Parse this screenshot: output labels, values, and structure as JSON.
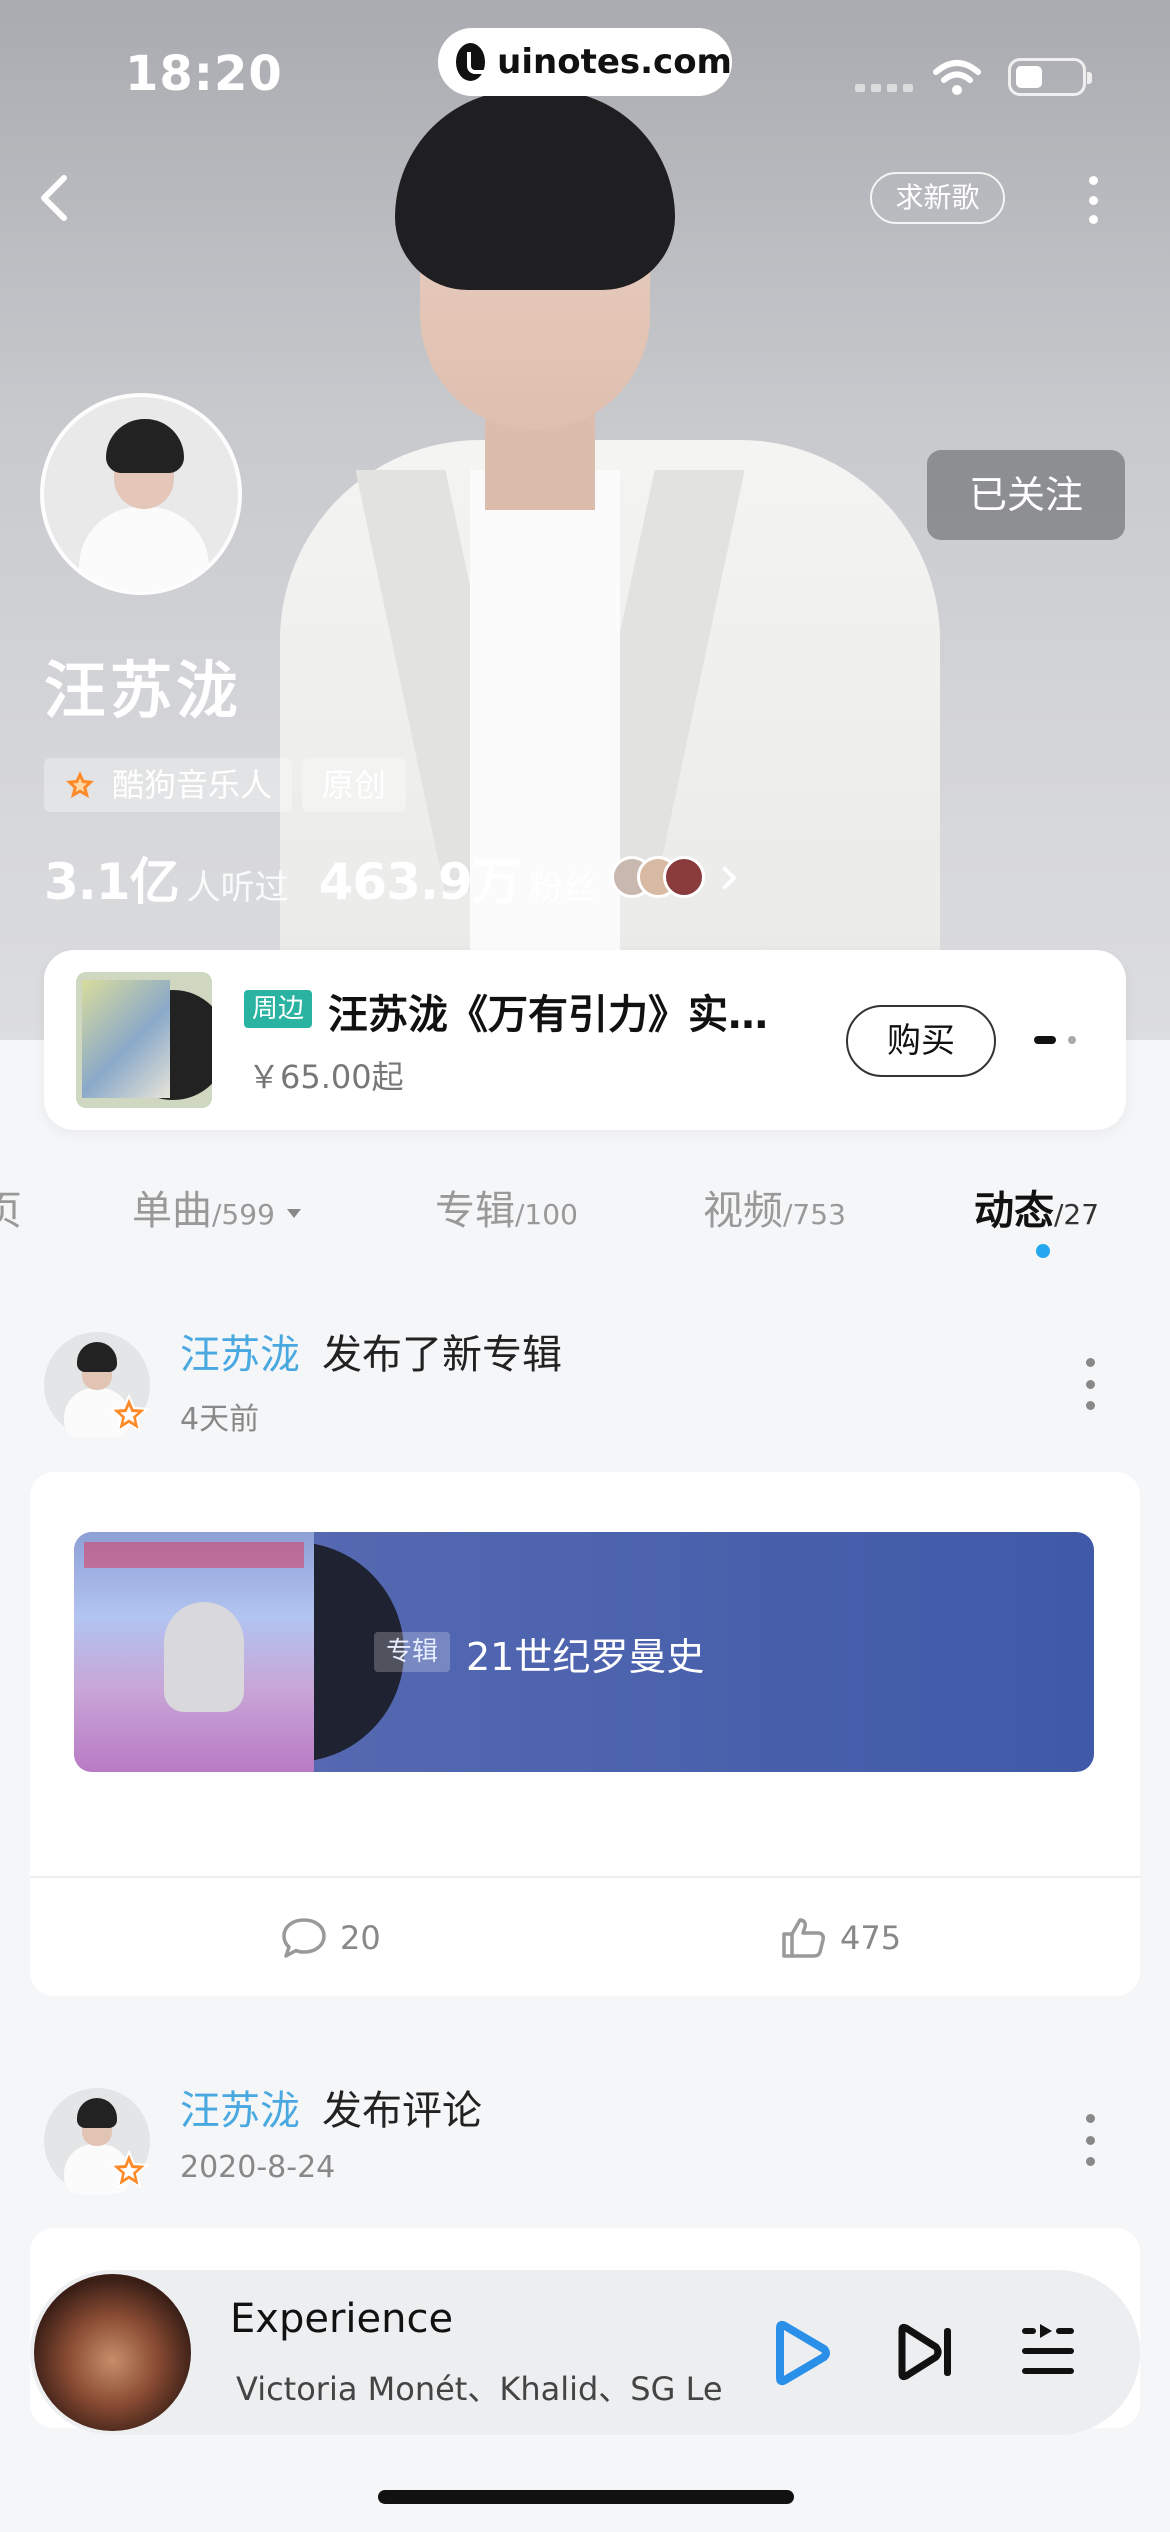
{
  "status_bar": {
    "time": "18:20",
    "url": "uinotes.com"
  },
  "header": {
    "request_song_label": "求新歌",
    "follow_label": "已关注"
  },
  "artist": {
    "name": "汪苏泷",
    "tags": [
      "酷狗音乐人",
      "原创"
    ],
    "listeners_value": "3.1亿",
    "listeners_label": "人听过",
    "fans_value": "463.9万",
    "fans_label": "粉丝"
  },
  "merch": {
    "tag": "周边",
    "title": "汪苏泷《万有引力》实…",
    "price": "￥65.00起",
    "buy_label": "购买"
  },
  "tabs": [
    {
      "label": "页",
      "count": ""
    },
    {
      "label": "单曲",
      "count": "/599"
    },
    {
      "label": "专辑",
      "count": "/100"
    },
    {
      "label": "视频",
      "count": "/753"
    },
    {
      "label": "动态",
      "count": "/27"
    }
  ],
  "active_tab": "动态",
  "feed": [
    {
      "author": "汪苏泷",
      "action": "发布了新专辑",
      "time": "4天前",
      "album_tag": "专辑",
      "album_title": "21世纪罗曼史",
      "comments": "20",
      "likes": "475"
    },
    {
      "author": "汪苏泷",
      "action": "发布评论",
      "time": "2020-8-24"
    }
  ],
  "player": {
    "title": "Experience",
    "artist": "Victoria Monét、Khalid、SG Le"
  },
  "colors": {
    "accent_blue": "#4aa8e0",
    "tab_indicator": "#25a7f0",
    "merch_tag": "#2bb3a2",
    "album_bar": "#4a62b0",
    "play_blue": "#2a8fe8"
  }
}
